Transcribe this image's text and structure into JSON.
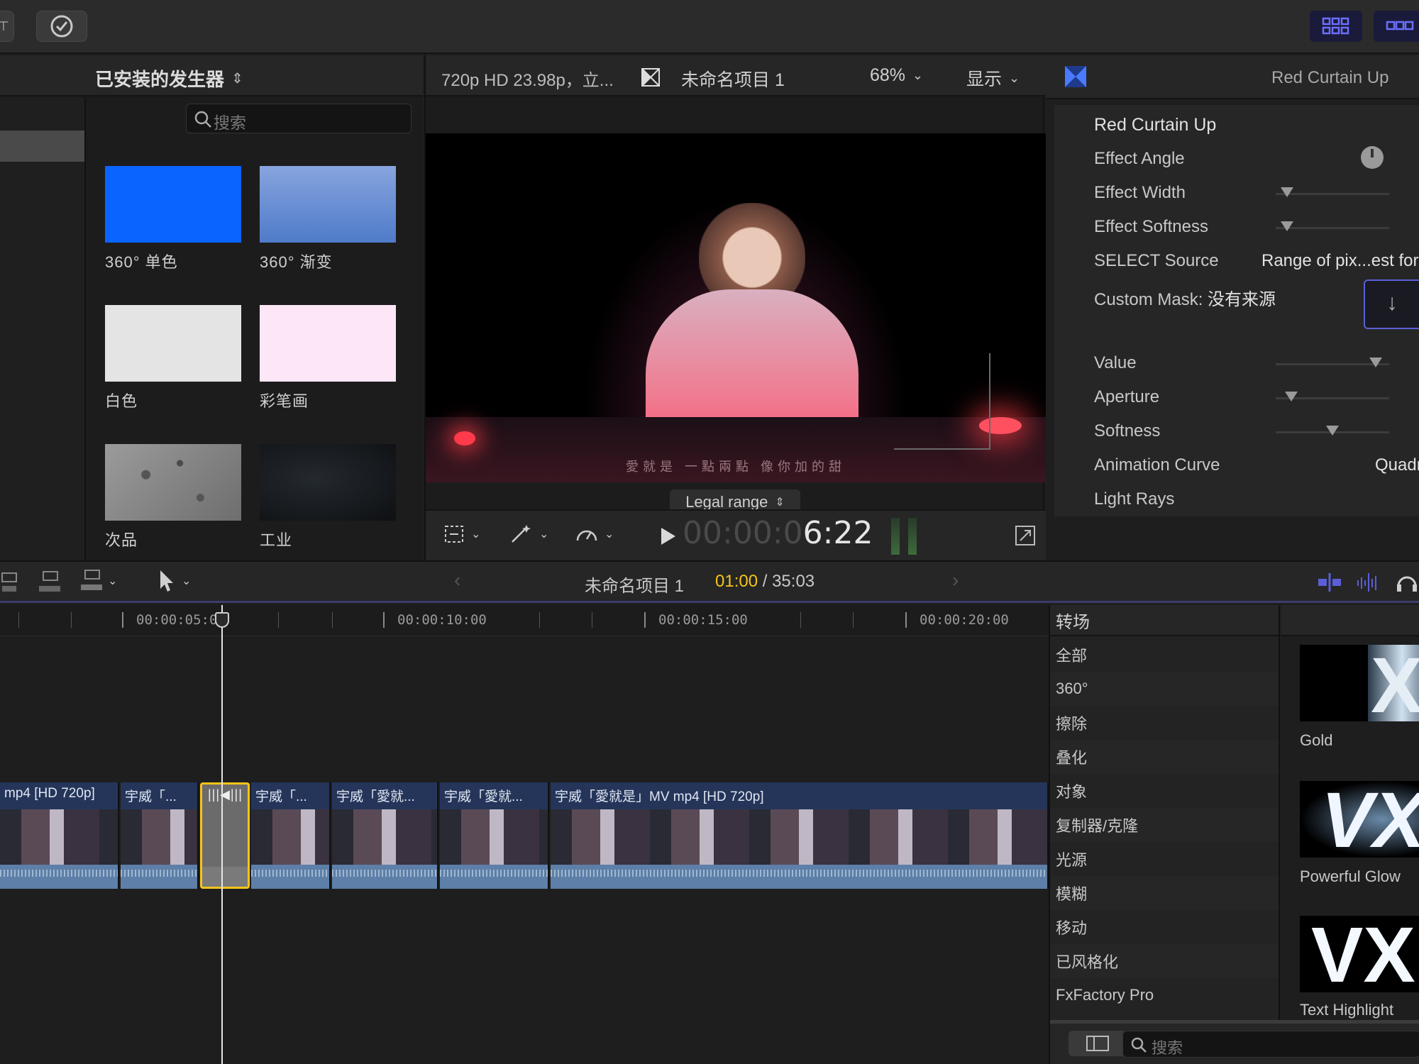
{
  "browser": {
    "header_title": "已安装的发生器",
    "search_placeholder": "搜索",
    "generators": [
      {
        "label": "360° 单色",
        "color": "#0a64ff"
      },
      {
        "label": "360° 渐变",
        "color": "#6f95d8"
      },
      {
        "label": "白色",
        "color": "#e6e6e6"
      },
      {
        "label": "彩笔画",
        "color": "#fde6f6"
      },
      {
        "label": "次品",
        "color": "#8a8a8a"
      },
      {
        "label": "工业",
        "color": "#15191d"
      }
    ]
  },
  "viewer": {
    "format_label": "720p HD 23.98p，立...",
    "project_name": "未命名项目 1",
    "zoom": "68%",
    "view_menu": "显示",
    "range_selector": "Legal range",
    "subtitle": "愛就是 一點兩點 像你加的甜",
    "timecode_dim": "00:00:0",
    "timecode_bright": "6:22"
  },
  "inspector": {
    "header_title": "Red Curtain Up",
    "effect_name": "Red Curtain Up",
    "params": {
      "angle": "Effect Angle",
      "width": "Effect Width",
      "softness": "Effect Softness",
      "select_source": "SELECT Source",
      "select_source_value": "Range of pix...est for",
      "custom_mask": "Custom Mask:",
      "custom_mask_value": "没有来源",
      "value": "Value",
      "aperture": "Aperture",
      "softness2": "Softness",
      "anim_curve": "Animation Curve",
      "anim_curve_value": "Quadra",
      "light_rays": "Light Rays"
    },
    "slider_levels": {
      "width": 0.1,
      "softness": 0.1,
      "value": 0.88,
      "aperture": 0.14,
      "softness2": 0.5
    }
  },
  "timeline_bar": {
    "project_name": "未命名项目 1",
    "position": "01:00",
    "separator": "/",
    "duration": "35:03"
  },
  "ruler": {
    "labels": [
      "00:00:05:00",
      "00:00:10:00",
      "00:00:15:00",
      "00:00:20:00"
    ]
  },
  "clips": [
    {
      "title": "mp4 [HD 720p]"
    },
    {
      "title": "宇威「..."
    },
    {
      "title": ""
    },
    {
      "title": "宇威「..."
    },
    {
      "title": "宇威「愛就..."
    },
    {
      "title": "宇威「愛就..."
    },
    {
      "title": "宇威「愛就是」MV mp4 [HD 720p]"
    }
  ],
  "transitions": {
    "header": "转场",
    "categories": [
      "全部",
      "360°",
      "擦除",
      "叠化",
      "对象",
      "复制器/克隆",
      "光源",
      "模糊",
      "移动",
      "已风格化",
      "FxFactory Pro"
    ],
    "items": [
      {
        "label": "Gold"
      },
      {
        "label": "Powerful Glow"
      },
      {
        "label": "Text Highlight"
      }
    ],
    "search_placeholder": "搜索"
  },
  "colors": {
    "accent_yellow": "#f5c518",
    "accent_purple": "#5b5fd6",
    "clip_blue": "#25355a"
  }
}
